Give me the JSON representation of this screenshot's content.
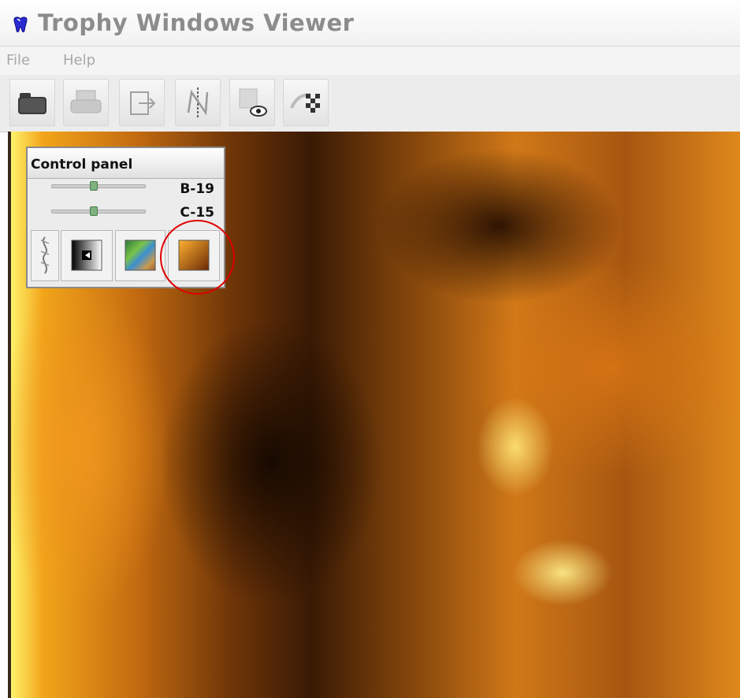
{
  "window": {
    "title": "Trophy Windows Viewer"
  },
  "menu": {
    "items": [
      "File",
      "Help"
    ]
  },
  "toolbar": {
    "buttons": [
      "open-icon",
      "print-icon",
      "export-icon",
      "flip-icon",
      "view-icon",
      "compare-icon"
    ]
  },
  "control_panel": {
    "title": "Control panel",
    "brightness": {
      "label": "B-19",
      "value": 19,
      "position": 0.44
    },
    "contrast": {
      "label": "C-15",
      "value": 15,
      "position": 0.44
    },
    "buttons": [
      "filter-icon",
      "invert-icon",
      "color-map-icon",
      "sepia-color-icon"
    ]
  },
  "colors": {
    "highlight": "#e00000",
    "xray_tint": "#f2a51a"
  }
}
